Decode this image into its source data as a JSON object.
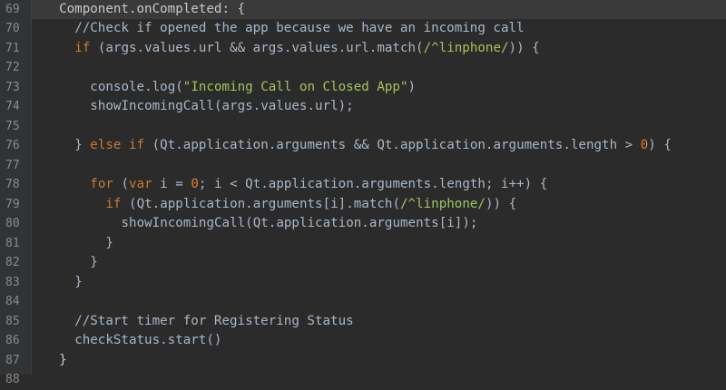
{
  "editor": {
    "lines": [
      {
        "n": "69",
        "indent": 2,
        "tokens": [
          {
            "t": "Component.onCompleted: {",
            "c": "plain"
          }
        ]
      },
      {
        "n": "70",
        "indent": 4,
        "tokens": [
          {
            "t": "//Check if opened the app because we have an incoming call",
            "c": "comment"
          }
        ]
      },
      {
        "n": "71",
        "indent": 4,
        "tokens": [
          {
            "t": "if",
            "c": "keyword"
          },
          {
            "t": " (args.values.url && args.values.url.match(",
            "c": "ident"
          },
          {
            "t": "/^linphone/",
            "c": "string"
          },
          {
            "t": ")) {",
            "c": "ident"
          }
        ]
      },
      {
        "n": "72",
        "indent": 0,
        "tokens": []
      },
      {
        "n": "73",
        "indent": 6,
        "tokens": [
          {
            "t": "console.log(",
            "c": "ident"
          },
          {
            "t": "\"Incoming Call on Closed App\"",
            "c": "string"
          },
          {
            "t": ")",
            "c": "ident"
          }
        ]
      },
      {
        "n": "74",
        "indent": 6,
        "tokens": [
          {
            "t": "showIncomingCall(args.values.url);",
            "c": "ident"
          }
        ]
      },
      {
        "n": "75",
        "indent": 0,
        "tokens": []
      },
      {
        "n": "76",
        "indent": 4,
        "tokens": [
          {
            "t": "} ",
            "c": "ident"
          },
          {
            "t": "else if",
            "c": "keyword"
          },
          {
            "t": " (Qt.application.arguments && Qt.application.arguments.length > ",
            "c": "ident"
          },
          {
            "t": "0",
            "c": "number"
          },
          {
            "t": ") {",
            "c": "ident"
          }
        ]
      },
      {
        "n": "77",
        "indent": 0,
        "tokens": []
      },
      {
        "n": "78",
        "indent": 6,
        "tokens": [
          {
            "t": "for",
            "c": "keyword"
          },
          {
            "t": " (",
            "c": "ident"
          },
          {
            "t": "var",
            "c": "keyword"
          },
          {
            "t": " i = ",
            "c": "ident"
          },
          {
            "t": "0",
            "c": "number"
          },
          {
            "t": "; i < Qt.application.arguments.length; i++) {",
            "c": "ident"
          }
        ]
      },
      {
        "n": "79",
        "indent": 8,
        "tokens": [
          {
            "t": "if",
            "c": "keyword"
          },
          {
            "t": " (Qt.application.arguments[i].match(",
            "c": "ident"
          },
          {
            "t": "/^linphone/",
            "c": "string"
          },
          {
            "t": ")) {",
            "c": "ident"
          }
        ]
      },
      {
        "n": "80",
        "indent": 10,
        "tokens": [
          {
            "t": "showIncomingCall(Qt.application.arguments[i]);",
            "c": "ident"
          }
        ]
      },
      {
        "n": "81",
        "indent": 8,
        "tokens": [
          {
            "t": "}",
            "c": "ident"
          }
        ]
      },
      {
        "n": "82",
        "indent": 6,
        "tokens": [
          {
            "t": "}",
            "c": "ident"
          }
        ]
      },
      {
        "n": "83",
        "indent": 4,
        "tokens": [
          {
            "t": "}",
            "c": "ident"
          }
        ]
      },
      {
        "n": "84",
        "indent": 0,
        "tokens": []
      },
      {
        "n": "85",
        "indent": 4,
        "tokens": [
          {
            "t": "//Start timer for Registering Status",
            "c": "comment"
          }
        ]
      },
      {
        "n": "86",
        "indent": 4,
        "tokens": [
          {
            "t": "checkStatus.start()",
            "c": "ident"
          }
        ]
      },
      {
        "n": "87",
        "indent": 2,
        "tokens": [
          {
            "t": "}",
            "c": "plain"
          }
        ]
      },
      {
        "n": "88",
        "indent": 0,
        "tokens": []
      }
    ]
  }
}
